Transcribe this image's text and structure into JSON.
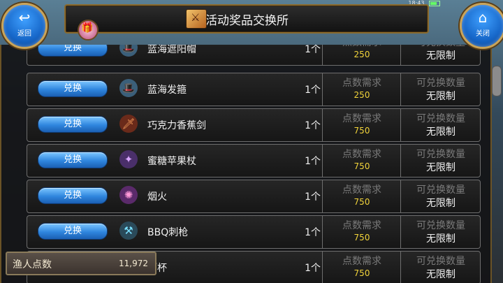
{
  "status": {
    "time": "18:43"
  },
  "header": {
    "title": "活动奖品交换所"
  },
  "nav": {
    "back_label": "返回",
    "close_label": "关闭"
  },
  "column_labels": {
    "points": "点数需求",
    "limit": "可兑换数量"
  },
  "exchange_label": "兑换",
  "items": [
    {
      "name": "蓝海遮阳帽",
      "qty": "1个",
      "points": "250",
      "limit": "无限制",
      "icon": "hat-icon"
    },
    {
      "name": "蓝海发箍",
      "qty": "1个",
      "points": "250",
      "limit": "无限制",
      "icon": "hat-icon"
    },
    {
      "name": "巧克力香蕉剑",
      "qty": "1个",
      "points": "750",
      "limit": "无限制",
      "icon": "sword-icon"
    },
    {
      "name": "蜜糖苹果杖",
      "qty": "1个",
      "points": "750",
      "limit": "无限制",
      "icon": "staff-icon"
    },
    {
      "name": "烟火",
      "qty": "1个",
      "points": "750",
      "limit": "无限制",
      "icon": "firework-icon"
    },
    {
      "name": "BBQ刺枪",
      "qty": "1个",
      "points": "750",
      "limit": "无限制",
      "icon": "spear-icon"
    },
    {
      "name": "酒杯",
      "qty": "1个",
      "points": "750",
      "limit": "无限制",
      "icon": "cup-icon"
    }
  ],
  "footer": {
    "points_label": "渔人点数",
    "points_value": "11,972"
  }
}
